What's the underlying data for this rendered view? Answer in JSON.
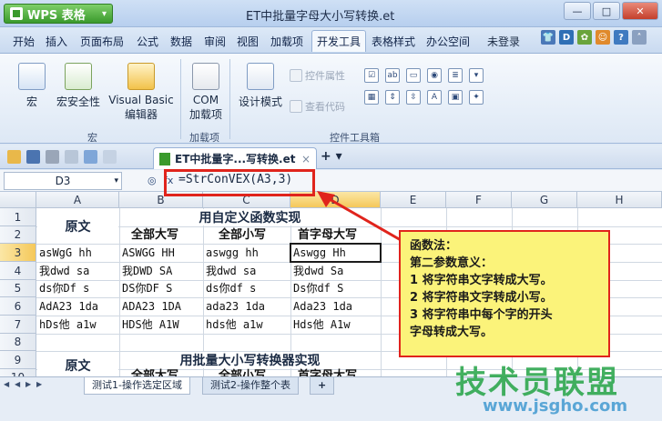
{
  "titlebar": {
    "app_button": "WPS 表格",
    "title": "ET中批量字母大小写转换.et"
  },
  "menu": {
    "tabs": [
      "开始",
      "插入",
      "页面布局",
      "公式",
      "数据",
      "审阅",
      "视图",
      "加载项",
      "开发工具",
      "表格样式",
      "办公空间"
    ],
    "active": "开发工具",
    "login": "未登录"
  },
  "ribbon": {
    "macro": "宏",
    "macro_security": "宏安全性",
    "vb_editor_1": "Visual Basic",
    "vb_editor_2": "编辑器",
    "group_macro": "宏",
    "com_1": "COM",
    "com_2": "加载项",
    "group_addins": "加载项",
    "design_mode": "设计模式",
    "control_props": "控件属性",
    "view_code": "查看代码",
    "group_controls": "控件工具箱"
  },
  "doc": {
    "tab_title": "ET中批量字...写转换.et"
  },
  "formula_bar": {
    "name_box": "D3",
    "formula": "=StrConVEX(A3,3)"
  },
  "sheet": {
    "columns": [
      "A",
      "B",
      "C",
      "D",
      "E",
      "F",
      "G",
      "H"
    ],
    "rows": [
      "1",
      "2",
      "3",
      "4",
      "5",
      "6",
      "7",
      "8",
      "9",
      "10"
    ],
    "header1": "原文",
    "section1": "用自定义函数实现",
    "subheaders": [
      "全部大写",
      "全部小写",
      "首字母大写"
    ],
    "data": [
      [
        "asWgG hh",
        "ASWGG HH",
        "aswgg hh",
        "Aswgg Hh"
      ],
      [
        "我dwd sa",
        "我DWD SA",
        "我dwd sa",
        "我dwd Sa"
      ],
      [
        "ds你Df s",
        "DS你DF S",
        "ds你df s",
        "Ds你df S"
      ],
      [
        "AdA23 1da",
        "ADA23 1DA",
        "ada23 1da",
        "Ada23 1da"
      ],
      [
        "hDs他 a1w",
        "HDS他 A1W",
        "hds他 a1w",
        "Hds他 A1w"
      ]
    ],
    "header2": "原文",
    "section2": "用批量大小写转换器实现",
    "subheaders2": [
      "全部大写",
      "全部小写",
      "首字母大写"
    ]
  },
  "note": {
    "lines": [
      "函数法：",
      "第二参数意义：",
      "1 将字符串文字转成大写。",
      "2 将字符串文字转成小写。",
      "3 将字符串中每个字的开头",
      "字母转成大写。"
    ]
  },
  "sheet_tabs": [
    "测试1-操作选定区域",
    "测试2-操作整个表"
  ],
  "watermark": {
    "text": "技术员联盟",
    "url": "www.jsgho.com"
  }
}
